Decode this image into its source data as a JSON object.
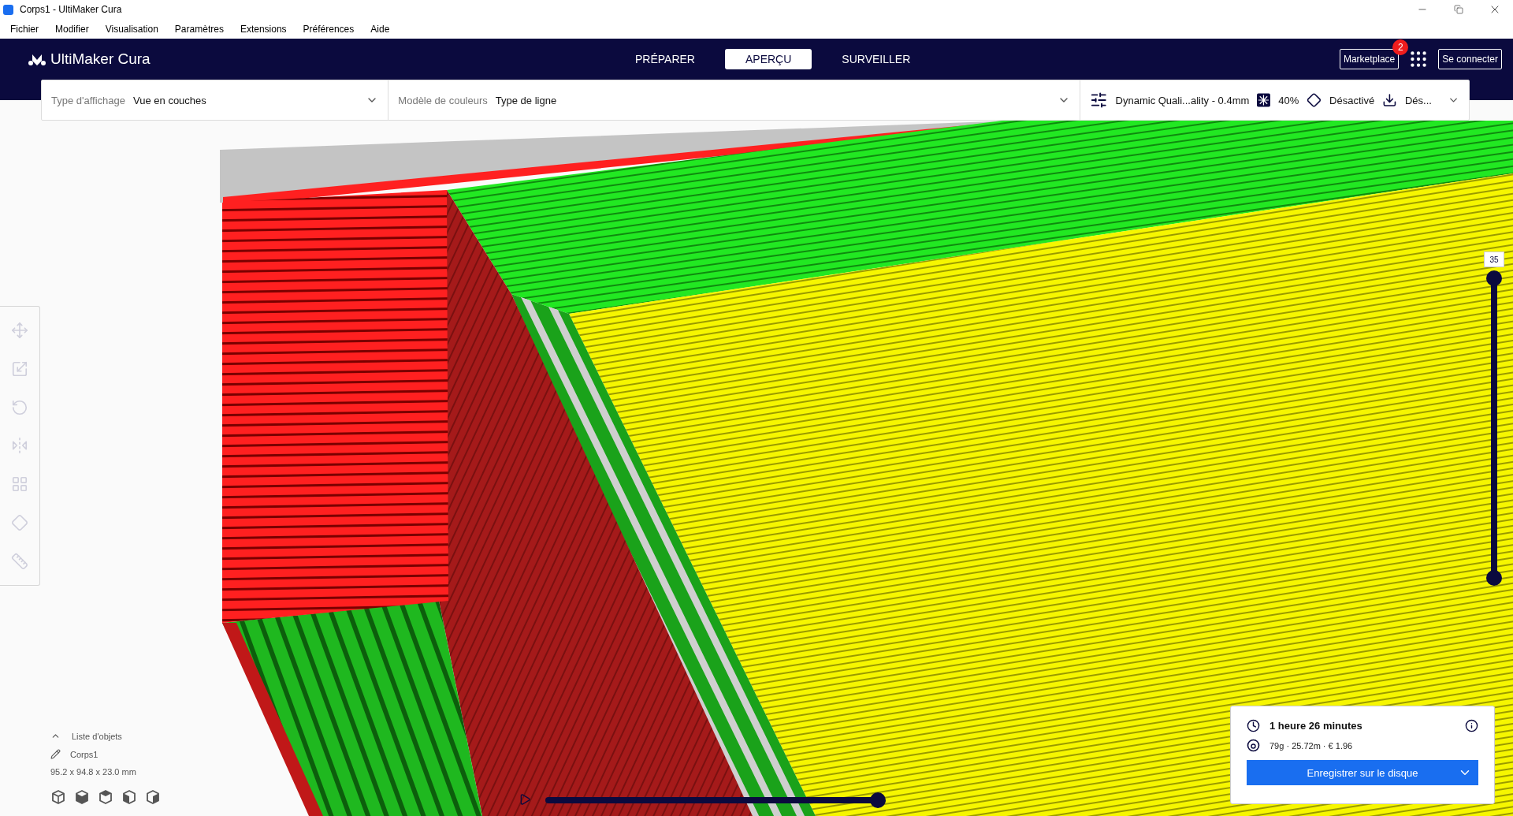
{
  "window": {
    "title": "Corps1 - UltiMaker Cura"
  },
  "menu": [
    "Fichier",
    "Modifier",
    "Visualisation",
    "Paramètres",
    "Extensions",
    "Préférences",
    "Aide"
  ],
  "header": {
    "logo": "UltiMaker Cura",
    "tabs": [
      {
        "label": "PRÉPARER",
        "selected": false
      },
      {
        "label": "APERÇU",
        "selected": true
      },
      {
        "label": "SURVEILLER",
        "selected": false
      }
    ],
    "marketplace": {
      "label": "Marketplace",
      "badge": "2"
    },
    "sign_in": "Se connecter"
  },
  "view_toolbar": {
    "view_type": {
      "label": "Type d'affichage",
      "value": "Vue en couches"
    },
    "color_scheme": {
      "label": "Modèle de couleurs",
      "value": "Type de ligne"
    },
    "print_setup": {
      "profile": "Dynamic Quali...ality - 0.4mm",
      "infill": "40%",
      "support": "Désactivé",
      "adhesion": "Dés..."
    }
  },
  "tools": [
    {
      "kind": "move",
      "disabled": true
    },
    {
      "kind": "scale",
      "disabled": true
    },
    {
      "kind": "rotate",
      "disabled": true
    },
    {
      "kind": "mirror",
      "disabled": true
    },
    {
      "kind": "per_model",
      "disabled": true
    },
    {
      "kind": "support_blocker",
      "disabled": true
    },
    {
      "kind": "measure",
      "disabled": true
    }
  ],
  "object_list": {
    "title": "Liste d'objets",
    "expanded": true,
    "objects": [
      {
        "name": "Corps1"
      }
    ],
    "dimensions": "95.2 x 94.8 x 23.0 mm"
  },
  "layer_slider": {
    "value": "35",
    "handles": [
      {
        "level": 1
      },
      {
        "level": 0
      }
    ]
  },
  "path_slider": {
    "level": 1
  },
  "print_info": {
    "time": "1 heure 26 minutes",
    "material": "79g · 25.72m · € 1.96",
    "save_button": "Enregistrer sur le disque"
  }
}
